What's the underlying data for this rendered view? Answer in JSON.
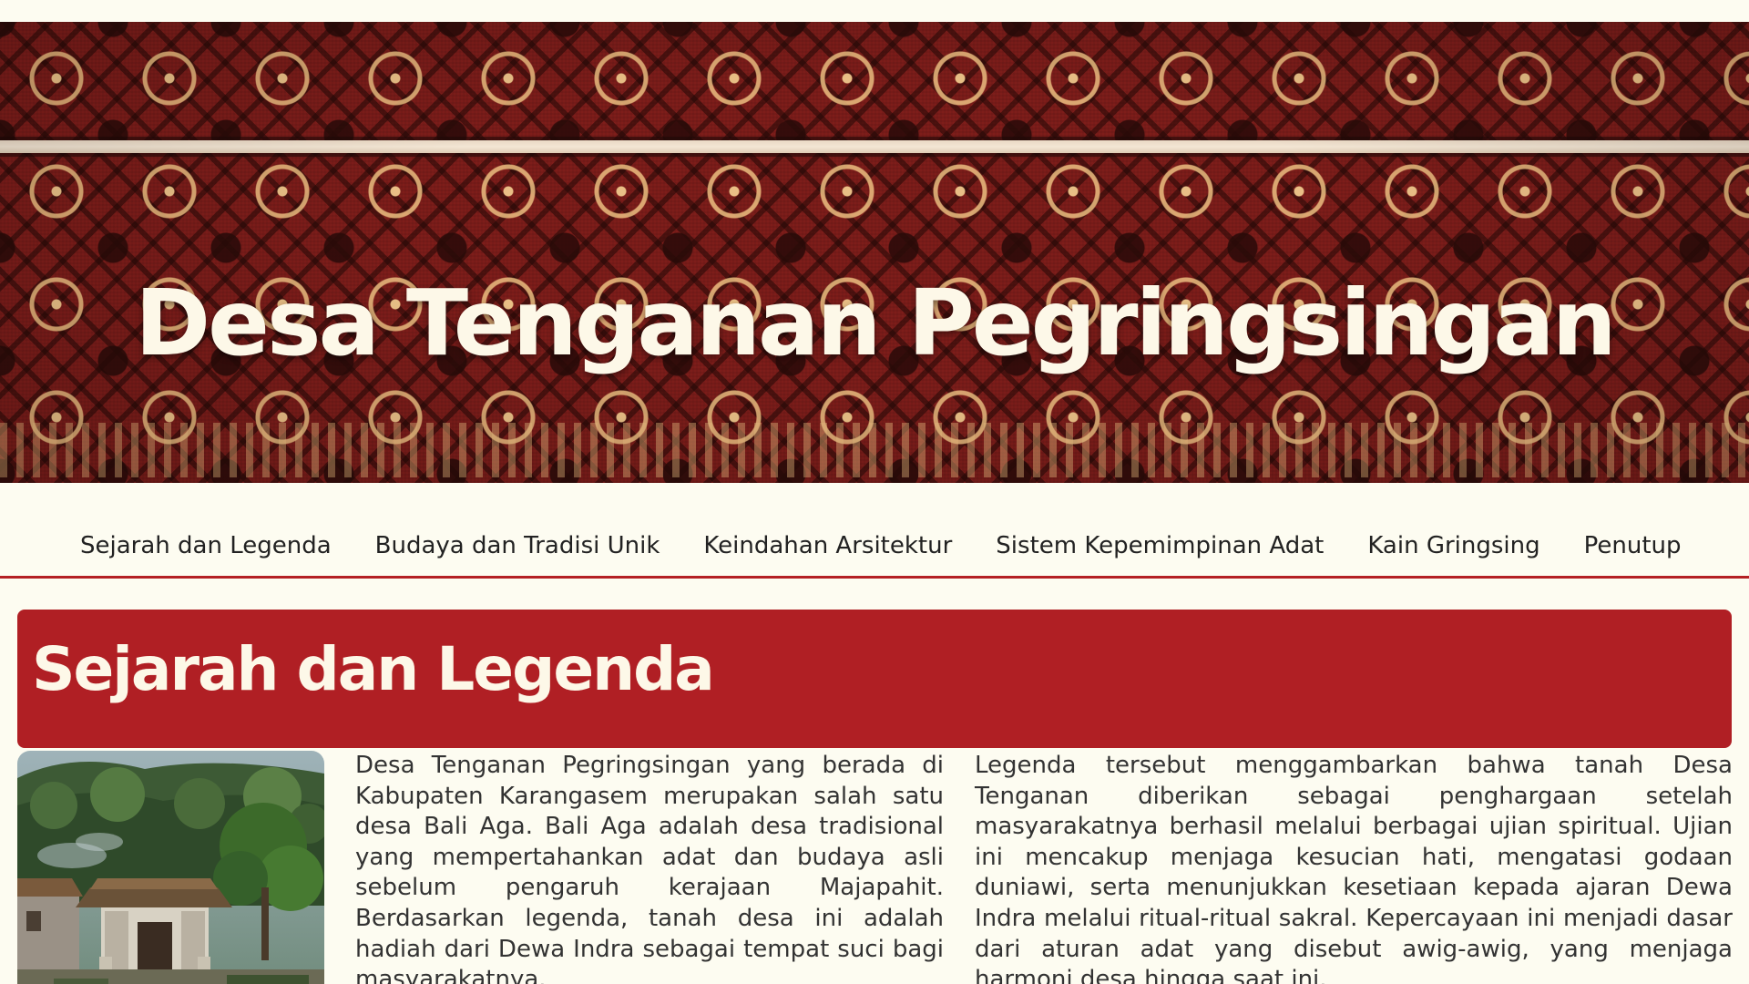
{
  "hero": {
    "title": "Desa Tenganan Pegringsingan"
  },
  "nav": {
    "items": [
      {
        "label": "Sejarah dan Legenda"
      },
      {
        "label": "Budaya dan Tradisi Unik"
      },
      {
        "label": "Keindahan Arsitektur"
      },
      {
        "label": "Sistem Kepemimpinan Adat"
      },
      {
        "label": "Kain Gringsing"
      },
      {
        "label": "Penutup"
      }
    ]
  },
  "section": {
    "title": "Sejarah dan Legenda",
    "paragraphs": [
      "Desa Tenganan Pegringsingan yang berada di Kabupaten Karangasem merupakan salah satu desa Bali Aga. Bali Aga adalah desa tradisional yang mempertahankan adat dan budaya asli sebelum pengaruh kerajaan Majapahit. Berdasarkan legenda, tanah desa ini adalah hadiah dari Dewa Indra sebagai tempat suci bagi masyarakatnya.",
      "Legenda tersebut menggambarkan bahwa tanah Desa Tenganan diberikan sebagai penghargaan setelah masyarakatnya berhasil melalui berbagai ujian spiritual. Ujian ini mencakup menjaga kesucian hati, mengatasi godaan duniawi, serta menunjukkan kesetiaan kepada ajaran Dewa Indra melalui ritual-ritual sakral. Kepercayaan ini menjadi dasar dari aturan adat yang disebut awig-awig, yang menjaga harmoni desa hingga saat ini."
    ]
  },
  "colors": {
    "page_background": "#fdfcf1",
    "accent_red": "#b01f24",
    "hero_text": "#fdf8e8",
    "body_text": "#333333"
  }
}
